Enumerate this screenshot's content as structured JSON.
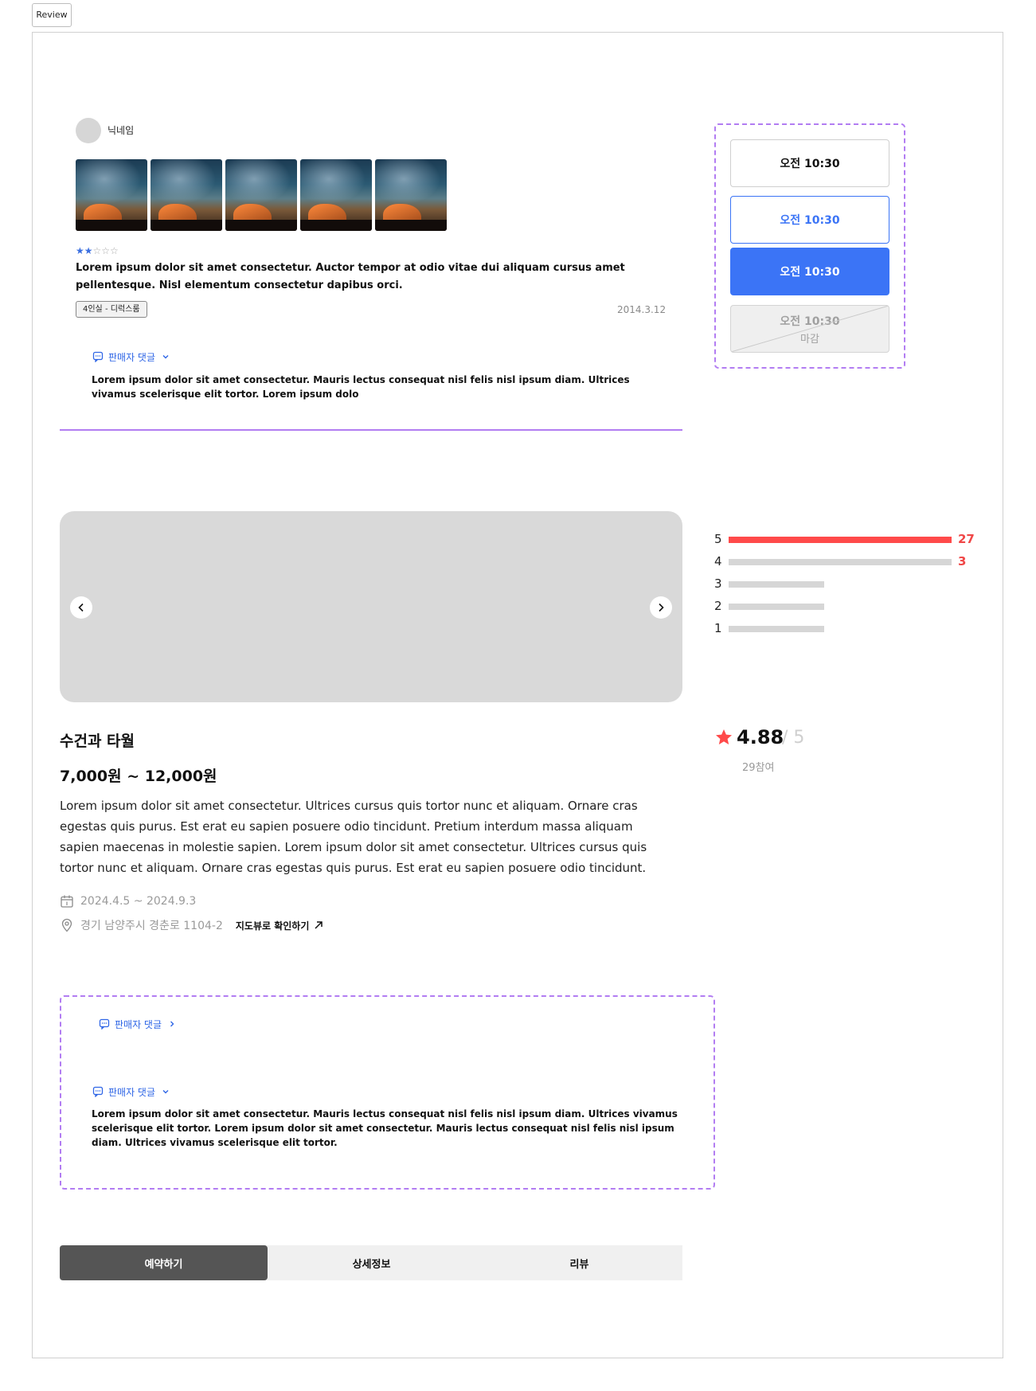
{
  "tag": {
    "label": "Review"
  },
  "review": {
    "nickname": "닉네임",
    "rating": 2,
    "stars_on": "★★",
    "stars_off": "☆☆☆",
    "text": "Lorem ipsum dolor sit amet consectetur. Auctor tempor at odio vitae dui aliquam cursus amet pellentesque. Nisl elementum consectetur dapibus orci.",
    "room_tag": "4인실 - 디럭스룸",
    "date": "2014.3.12",
    "seller_reply_label": "판매자 댓글",
    "seller_reply_text": "Lorem ipsum dolor sit amet consectetur. Mauris lectus consequat nisl felis nisl ipsum diam. Ultrices vivamus scelerisque elit tortor. Lorem ipsum dolo"
  },
  "time_slots": [
    {
      "time": "오전 10:30",
      "state": "default"
    },
    {
      "time": "오전 10:30",
      "state": "outlined"
    },
    {
      "time": "오전 10:30",
      "state": "selected"
    },
    {
      "time": "오전 10:30",
      "state": "closed",
      "sub": "마감"
    }
  ],
  "rating_summary": {
    "rows": [
      {
        "score": "5",
        "count": "27",
        "fraction": 1.0
      },
      {
        "score": "4",
        "count": "3",
        "fraction": 0.0
      },
      {
        "score": "3",
        "count": "",
        "fraction": 0.0
      },
      {
        "score": "2",
        "count": "",
        "fraction": 0.0
      },
      {
        "score": "1",
        "count": "",
        "fraction": 0.0
      }
    ],
    "average": "4.88",
    "max": "/ 5",
    "participants": "29참여",
    "accent_color": "#ff4a4a"
  },
  "product": {
    "title": "수건과 타월",
    "price": "7,000원 ~ 12,000원",
    "description": "Lorem ipsum dolor sit amet consectetur. Ultrices cursus quis tortor nunc et aliquam. Ornare cras egestas quis purus. Est erat eu sapien posuere odio tincidunt. Pretium interdum massa aliquam sapien maecenas in molestie sapien. Lorem ipsum dolor sit amet consectetur. Ultrices cursus quis tortor nunc et aliquam. Ornare cras egestas quis purus. Est erat eu sapien posuere odio tincidunt.",
    "period": "2024.4.5 ~ 2024.9.3",
    "address": "경기 남양주시 경춘로 1104-2",
    "map_link": "지도뷰로 확인하기"
  },
  "seller_box": {
    "collapsed_label": "판매자 댓글",
    "expanded_label": "판매자 댓글",
    "expanded_text": "Lorem ipsum dolor sit amet consectetur. Mauris lectus consequat nisl felis nisl ipsum diam. Ultrices vivamus scelerisque elit tortor. Lorem ipsum dolor sit amet consectetur. Mauris lectus consequat nisl felis nisl ipsum diam. Ultrices vivamus scelerisque elit tortor."
  },
  "tabs": [
    {
      "label": "예약하기",
      "active": true
    },
    {
      "label": "상세정보",
      "active": false
    },
    {
      "label": "리뷰",
      "active": false
    }
  ],
  "colors": {
    "primary": "#3b74f6",
    "accent_purple": "#b27df2",
    "rating_red": "#ff4a4a"
  }
}
